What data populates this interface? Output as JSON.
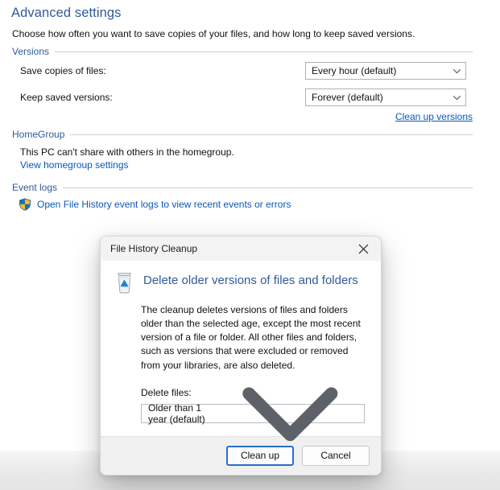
{
  "page": {
    "title": "Advanced settings",
    "subtitle": "Choose how often you want to save copies of your files, and how long to keep saved versions.",
    "groups": {
      "versions": "Versions",
      "homegroup": "HomeGroup",
      "event_logs": "Event logs"
    },
    "fields": {
      "save_copies_label": "Save copies of files:",
      "save_copies_value": "Every hour (default)",
      "keep_versions_label": "Keep saved versions:",
      "keep_versions_value": "Forever (default)"
    },
    "links": {
      "clean_up_versions": "Clean up versions",
      "view_homegroup_settings": "View homegroup settings",
      "open_event_logs": "Open File History event logs to view recent events or errors"
    },
    "homegroup_status": "This PC can't share with others in the homegroup.",
    "icons": {
      "shield": "shield-icon",
      "chevron": "chevron-down-icon"
    }
  },
  "dialog": {
    "title": "File History Cleanup",
    "close_label": "close-icon",
    "icon": "recycle-bin-icon",
    "heading": "Delete older versions of files and folders",
    "paragraph": "The cleanup deletes versions of files and folders older than the selected age, except the most recent version of a file or folder. All other files and folders, such as versions that were excluded or removed from your libraries, are also deleted.",
    "delete_files_label": "Delete files:",
    "delete_files_value": "Older than 1 year (default)",
    "buttons": {
      "primary": "Clean up",
      "secondary": "Cancel"
    }
  },
  "colors": {
    "accent_blue": "#2f5a99",
    "link_blue": "#0a58b8",
    "focus_border": "#2a6fc9",
    "rule": "#c8ced6"
  }
}
